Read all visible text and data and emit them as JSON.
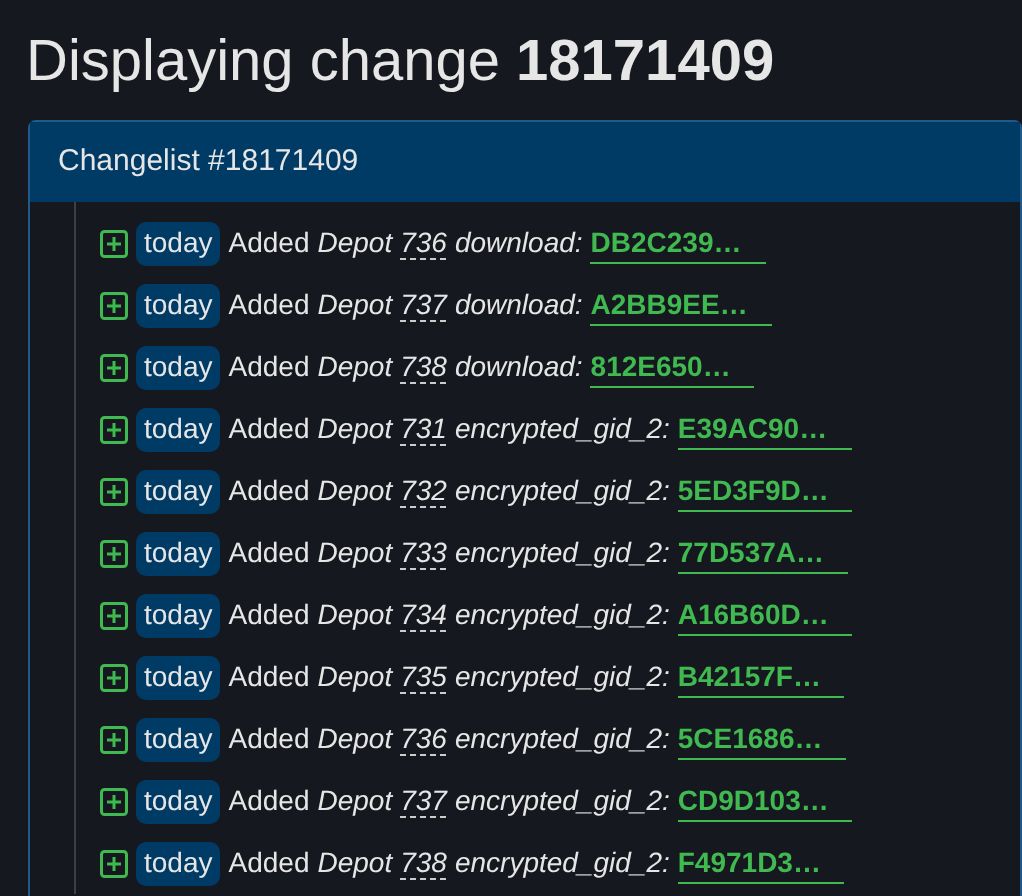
{
  "heading": {
    "text": "Displaying change",
    "number": "18171409"
  },
  "panel": {
    "title": "Changelist #18171409",
    "rows": [
      {
        "time": "today",
        "action": "Added",
        "object": "Depot",
        "id": "736",
        "key": "download:",
        "value": "DB2C239…"
      },
      {
        "time": "today",
        "action": "Added",
        "object": "Depot",
        "id": "737",
        "key": "download:",
        "value": "A2BB9EE…"
      },
      {
        "time": "today",
        "action": "Added",
        "object": "Depot",
        "id": "738",
        "key": "download:",
        "value": "812E650…"
      },
      {
        "time": "today",
        "action": "Added",
        "object": "Depot",
        "id": "731",
        "key": "encrypted_gid_2:",
        "value": "E39AC90…"
      },
      {
        "time": "today",
        "action": "Added",
        "object": "Depot",
        "id": "732",
        "key": "encrypted_gid_2:",
        "value": "5ED3F9D…"
      },
      {
        "time": "today",
        "action": "Added",
        "object": "Depot",
        "id": "733",
        "key": "encrypted_gid_2:",
        "value": "77D537A…"
      },
      {
        "time": "today",
        "action": "Added",
        "object": "Depot",
        "id": "734",
        "key": "encrypted_gid_2:",
        "value": "A16B60D…"
      },
      {
        "time": "today",
        "action": "Added",
        "object": "Depot",
        "id": "735",
        "key": "encrypted_gid_2:",
        "value": "B42157F…"
      },
      {
        "time": "today",
        "action": "Added",
        "object": "Depot",
        "id": "736",
        "key": "encrypted_gid_2:",
        "value": "5CE1686…"
      },
      {
        "time": "today",
        "action": "Added",
        "object": "Depot",
        "id": "737",
        "key": "encrypted_gid_2:",
        "value": "CD9D103…"
      },
      {
        "time": "today",
        "action": "Added",
        "object": "Depot",
        "id": "738",
        "key": "encrypted_gid_2:",
        "value": "F4971D3…"
      }
    ]
  }
}
